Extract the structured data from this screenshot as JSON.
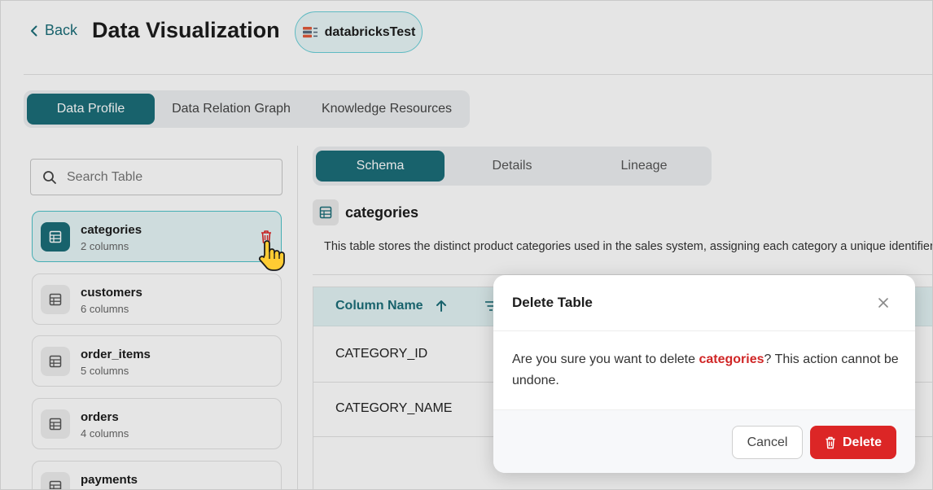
{
  "header": {
    "back_label": "Back",
    "title": "Data Visualization",
    "datasource": "databricksTest"
  },
  "top_tabs": [
    {
      "label": "Data Profile",
      "active": true
    },
    {
      "label": "Data Relation Graph",
      "active": false
    },
    {
      "label": "Knowledge Resources",
      "active": false
    }
  ],
  "sidebar": {
    "search_placeholder": "Search Table",
    "tables": [
      {
        "name": "categories",
        "columns": "2 columns",
        "active": true
      },
      {
        "name": "customers",
        "columns": "6 columns",
        "active": false
      },
      {
        "name": "order_items",
        "columns": "5 columns",
        "active": false
      },
      {
        "name": "orders",
        "columns": "4 columns",
        "active": false
      },
      {
        "name": "payments",
        "columns": "",
        "active": false
      }
    ]
  },
  "sub_tabs": [
    {
      "label": "Schema",
      "active": true
    },
    {
      "label": "Details",
      "active": false
    },
    {
      "label": "Lineage",
      "active": false
    }
  ],
  "main": {
    "table_title": "categories",
    "description": "This table stores the distinct product categories used in the sales system, assigning each category a unique identifier",
    "column_header": "Column Name",
    "rows": [
      "CATEGORY_ID",
      "CATEGORY_NAME"
    ]
  },
  "modal": {
    "title": "Delete Table",
    "message_before": "Are you sure you want to delete ",
    "message_highlight": "categories",
    "message_after": "? This action cannot be undone.",
    "cancel_label": "Cancel",
    "delete_label": "Delete"
  },
  "colors": {
    "accent": "#1b6e79",
    "danger": "#dc2626",
    "active_border": "#4fc2c9"
  },
  "icons": [
    "chevron-left-icon",
    "database-icon",
    "search-icon",
    "table-grid-icon",
    "trash-icon",
    "hand-pointer-icon",
    "arrow-up-icon",
    "filter-icon",
    "close-icon"
  ]
}
